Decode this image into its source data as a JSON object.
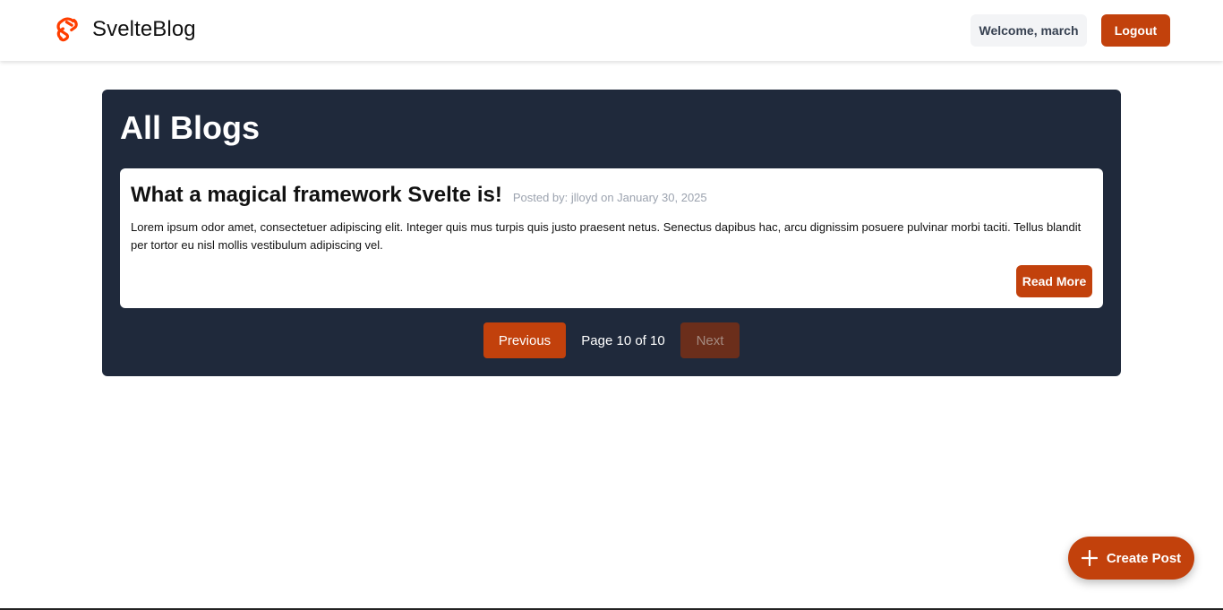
{
  "app": {
    "name": "SvelteBlog",
    "logo_icon": "svelte-logo-icon",
    "accent_color": "#c2410c"
  },
  "header": {
    "welcome_text": "Welcome, march",
    "logout_label": "Logout"
  },
  "main": {
    "title": "All Blogs",
    "posts": [
      {
        "title": "What a magical framework Svelte is!",
        "meta": "Posted by: jlloyd on January 30, 2025",
        "excerpt": "Lorem ipsum odor amet, consectetuer adipiscing elit. Integer quis mus turpis quis justo praesent netus. Senectus dapibus hac, arcu dignissim posuere pulvinar morbi taciti. Tellus blandit per tortor eu nisl mollis vestibulum adipiscing vel.",
        "read_more_label": "Read More"
      }
    ],
    "pagination": {
      "previous_label": "Previous",
      "page_text": "Page 10 of 10",
      "next_label": "Next",
      "current_page": 10,
      "total_pages": 10
    }
  },
  "fab": {
    "label": "Create Post",
    "icon": "plus-icon"
  }
}
